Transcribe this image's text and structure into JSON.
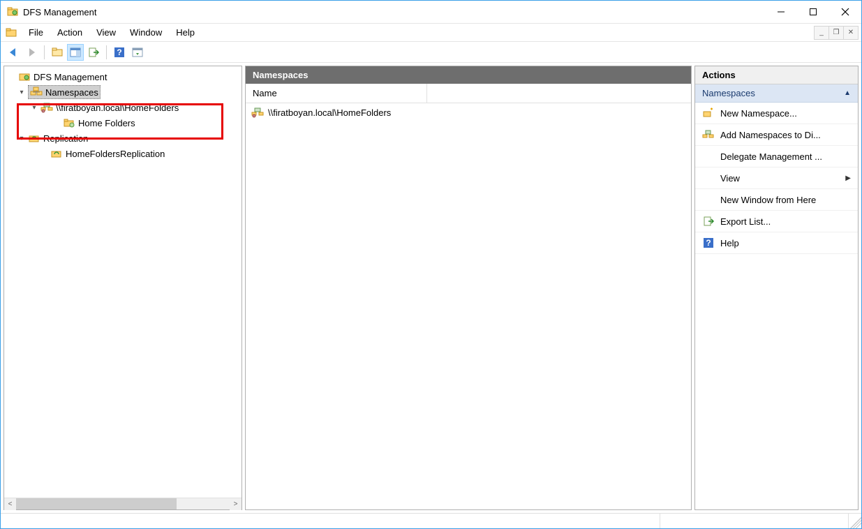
{
  "window": {
    "title": "DFS Management"
  },
  "menu": {
    "items": [
      "File",
      "Action",
      "View",
      "Window",
      "Help"
    ]
  },
  "tree": {
    "root": "DFS Management",
    "namespaces_label": "Namespaces",
    "namespace_path": "\\\\firatboyan.local\\HomeFolders",
    "namespace_child": "Home Folders",
    "replication_label": "Replication",
    "replication_child": "HomeFoldersReplication"
  },
  "detail": {
    "header": "Namespaces",
    "column": "Name",
    "row0": "\\\\firatboyan.local\\HomeFolders"
  },
  "actions": {
    "title": "Actions",
    "group": "Namespaces",
    "items": {
      "new_namespace": "New Namespace...",
      "add_namespaces": "Add Namespaces to Di...",
      "delegate": "Delegate Management ...",
      "view": "View",
      "new_window": "New Window from Here",
      "export_list": "Export List...",
      "help": "Help"
    }
  }
}
